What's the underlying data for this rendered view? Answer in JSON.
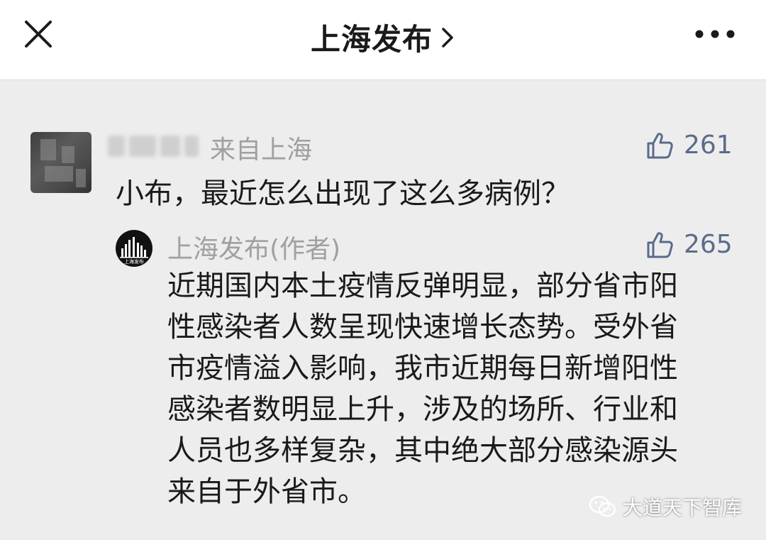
{
  "header": {
    "title": "上海发布",
    "title_chevron": "chevron-right-icon",
    "close_icon": "close-icon",
    "more_icon": "more-icon"
  },
  "comment": {
    "location": "来自上海",
    "likes": "261",
    "text": "小布，最近怎么出现了这么多病例？"
  },
  "reply": {
    "author": "上海发布(作者)",
    "avatar_text": "上海发布",
    "likes": "265",
    "lines": [
      "近期国内本土疫情反弹明显，部分省市阳",
      "性感染者人数呈现快速增长态势。受外省",
      "市疫情溢入影响，我市近期每日新增阳性",
      "感染者数明显上升，涉及的场所、行业和",
      "人员也多样复杂，其中绝大部分感染源头",
      "来自于外省市。"
    ]
  },
  "watermark": {
    "text": "大道天下智库"
  },
  "colors": {
    "background": "#ededed",
    "header": "#ffffff",
    "like": "#5b6b8a",
    "meta": "#a0a0a0",
    "text": "#1a1a1a"
  }
}
